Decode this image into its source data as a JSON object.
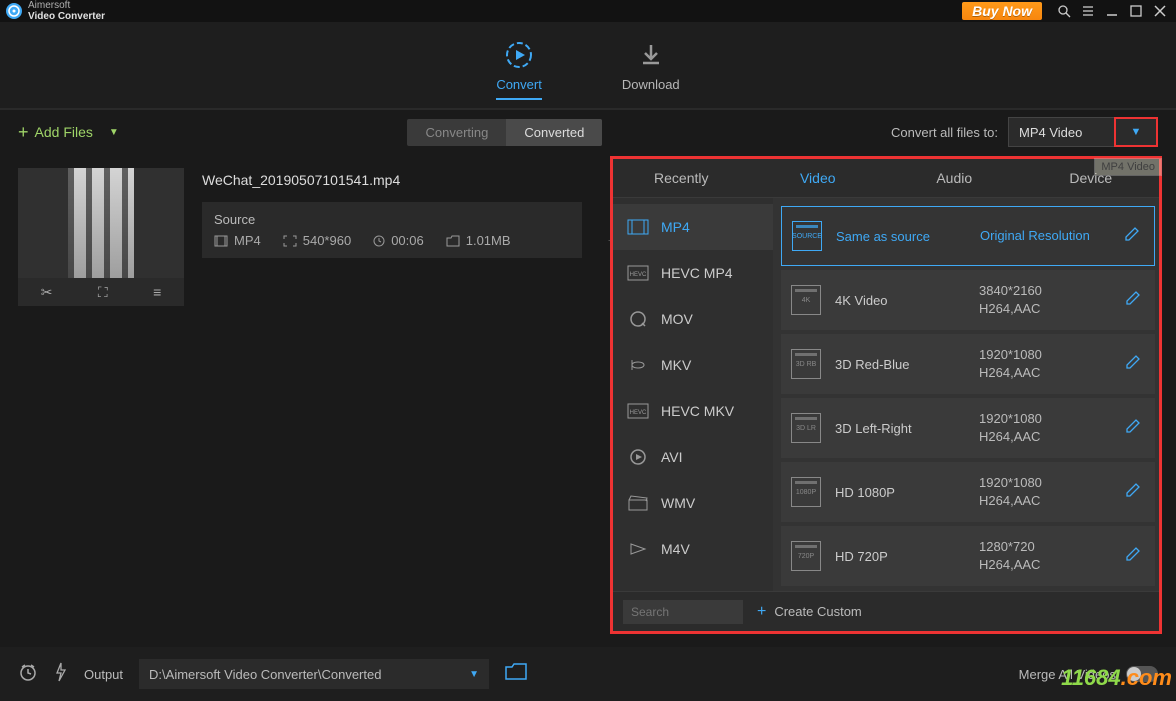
{
  "app": {
    "brand1": "Aimersoft",
    "brand2": "Video Converter"
  },
  "titlebar": {
    "buy_now": "Buy Now"
  },
  "nav": {
    "convert": "Convert",
    "download": "Download"
  },
  "toolbar": {
    "add_files": "Add Files",
    "converting": "Converting",
    "converted": "Converted",
    "convert_all_label": "Convert all files to:",
    "format_selected": "MP4 Video"
  },
  "file": {
    "name": "WeChat_20190507101541.mp4",
    "source_label": "Source",
    "format": "MP4",
    "resolution": "540*960",
    "duration": "00:06",
    "size": "1.01MB"
  },
  "popup": {
    "tabs": {
      "recently": "Recently",
      "video": "Video",
      "audio": "Audio",
      "device": "Device"
    },
    "formats": [
      "MP4",
      "HEVC MP4",
      "MOV",
      "MKV",
      "HEVC MKV",
      "AVI",
      "WMV",
      "M4V"
    ],
    "presets": [
      {
        "icon": "SOURCE",
        "title": "Same as source",
        "line1": "Original Resolution",
        "line2": ""
      },
      {
        "icon": "4K",
        "title": "4K Video",
        "line1": "3840*2160",
        "line2": "H264,AAC"
      },
      {
        "icon": "3D RB",
        "title": "3D Red-Blue",
        "line1": "1920*1080",
        "line2": "H264,AAC"
      },
      {
        "icon": "3D LR",
        "title": "3D Left-Right",
        "line1": "1920*1080",
        "line2": "H264,AAC"
      },
      {
        "icon": "1080P",
        "title": "HD 1080P",
        "line1": "1920*1080",
        "line2": "H264,AAC"
      },
      {
        "icon": "720P",
        "title": "HD 720P",
        "line1": "1280*720",
        "line2": "H264,AAC"
      }
    ],
    "search_placeholder": "Search",
    "create_custom": "Create Custom"
  },
  "bottom": {
    "output_label": "Output",
    "output_path": "D:\\Aimersoft Video Converter\\Converted",
    "merge_label": "Merge All Videos"
  },
  "watermark": {
    "a": "11684",
    "b": ".com"
  },
  "tooltip": "MP4 Video"
}
